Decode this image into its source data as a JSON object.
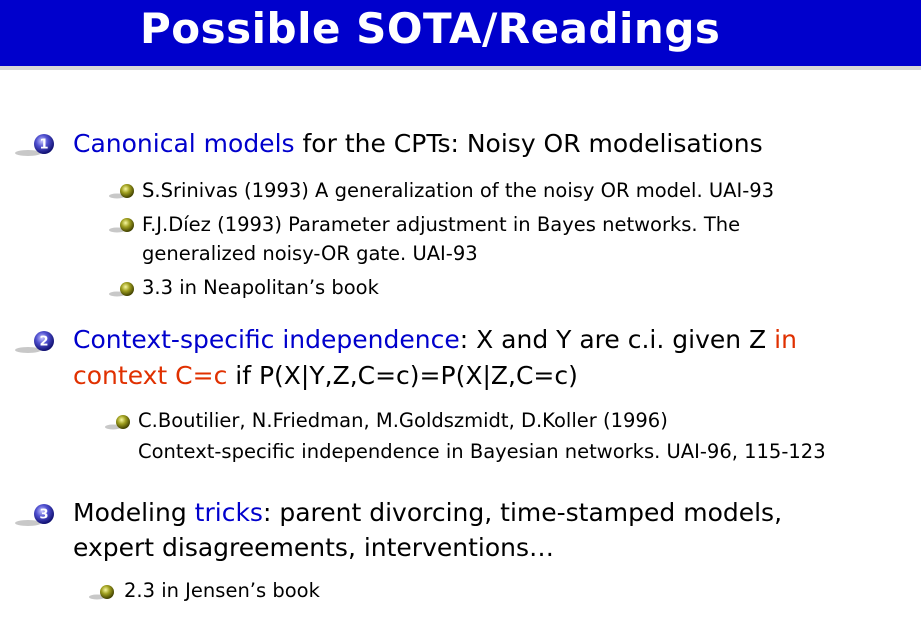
{
  "slide": {
    "title": "Possible SOTA/Readings"
  },
  "items": [
    {
      "number": "1",
      "line1": {
        "highlight": "Canonical models",
        "rest": " for the CPTs: Noisy OR modelisations"
      },
      "refs": [
        "S.Srinivas (1993) A generalization of the noisy OR model. UAI-93",
        "F.J.Díez (1993) Parameter adjustment in Bayes networks. The",
        "generalized noisy-OR gate. UAI-93",
        "3.3 in Neapolitan’s book"
      ]
    },
    {
      "number": "2",
      "line1": {
        "highlight": "Context-specific independence",
        "rest": ": X and Y are c.i. given Z ",
        "red": "in"
      },
      "line2": {
        "red": "context C=c",
        "rest": " if P(X|Y,Z,C=c)=P(X|Z,C=c)"
      },
      "refs": [
        "C.Boutilier, N.Friedman, M.Goldszmidt, D.Koller (1996)",
        "Context-specific independence in Bayesian networks. UAI-96, 115-123"
      ]
    },
    {
      "number": "3",
      "line1": {
        "pre": "Modeling ",
        "highlight": "tricks",
        "rest": ": parent divorcing, time-stamped models,"
      },
      "line2": {
        "rest": "expert disagreements, interventions…"
      },
      "refs": [
        "2.3 in Jensen’s book"
      ]
    }
  ],
  "colors": {
    "title_bar": "#0000cc",
    "highlight_blue": "#0000cc",
    "highlight_red": "#e03000"
  }
}
